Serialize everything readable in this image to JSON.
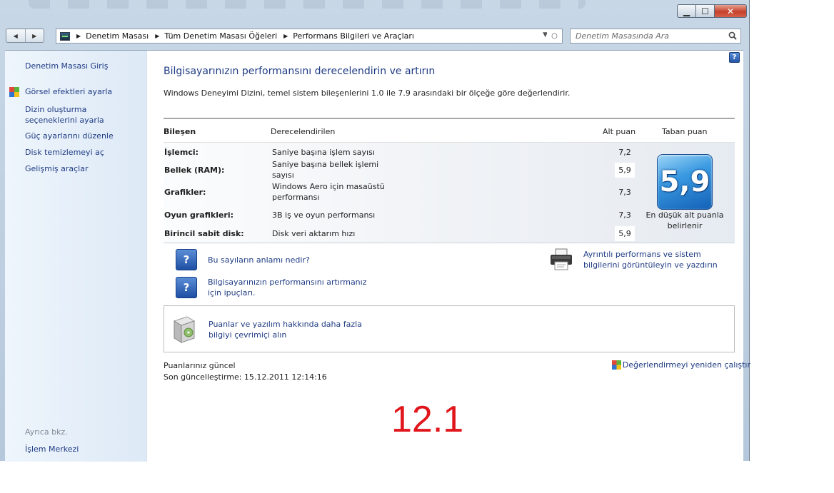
{
  "window": {
    "caption_min": "▁",
    "caption_max": "☐",
    "caption_close": "✕"
  },
  "breadcrumb": [
    "Denetim Masası",
    "Tüm Denetim Masası Öğeleri",
    "Performans Bilgileri ve Araçları"
  ],
  "search": {
    "placeholder": "Denetim Masasında Ara"
  },
  "sidebar": {
    "home": "Denetim Masası Giriş",
    "items": [
      {
        "label": "Görsel efektleri ayarla"
      },
      {
        "label": "Dizin oluşturma seçeneklerini ayarla"
      },
      {
        "label": "Güç ayarlarını düzenle"
      },
      {
        "label": "Disk temizlemeyi aç"
      },
      {
        "label": "Gelişmiş araçlar"
      }
    ],
    "see_also_title": "Ayrıca bkz.",
    "see_also_link": "İşlem Merkezi"
  },
  "main": {
    "title": "Bilgisayarınızın performansını derecelendirin ve artırın",
    "description": "Windows Deneyimi Dizini, temel sistem bileşenlerini 1.0 ile 7.9 arasındaki bir ölçeğe göre değerlendirir.",
    "table": {
      "headers": {
        "component": "Bileşen",
        "rated": "Derecelendirilen",
        "subscore": "Alt puan",
        "base": "Taban puan"
      },
      "rows": [
        {
          "component": "İşlemci:",
          "rated": "Saniye başına işlem sayısı",
          "score": "7,2"
        },
        {
          "component": "Bellek (RAM):",
          "rated": "Saniye başına bellek işlemi sayısı",
          "score": "5,9"
        },
        {
          "component": "Grafikler:",
          "rated": "Windows Aero için masaüstü performansı",
          "score": "7,3"
        },
        {
          "component": "Oyun grafikleri:",
          "rated": "3B iş ve oyun performansı",
          "score": "7,3"
        },
        {
          "component": "Birincil sabit disk:",
          "rated": "Disk veri aktarım hızı",
          "score": "5,9"
        }
      ],
      "base_score": "5,9",
      "base_caption": "En düşük alt puanla belirlenir"
    },
    "links": {
      "meaning": "Bu sayıların anlamı nedir?",
      "tips": "Bilgisayarınızın performansını artırmanız için ipuçları.",
      "details": "Ayrıntılı performans ve sistem bilgilerini görüntüleyin ve yazdırın",
      "online": "Puanlar ve yazılım hakkında daha fazla bilgiyi çevrimiçi alın",
      "rerun": "Değerlendirmeyi yeniden çalıştır"
    },
    "status": {
      "current": "Puanlarınız güncel",
      "last_update": "Son güncelleştirme: 15.12.2011 12:14:16"
    },
    "help_glyph": "?"
  },
  "overlay_label": "12.1",
  "colors": {
    "link": "#1e3b83",
    "overlay": "#e0161c",
    "sidebar_bg": "#dde9f6"
  }
}
